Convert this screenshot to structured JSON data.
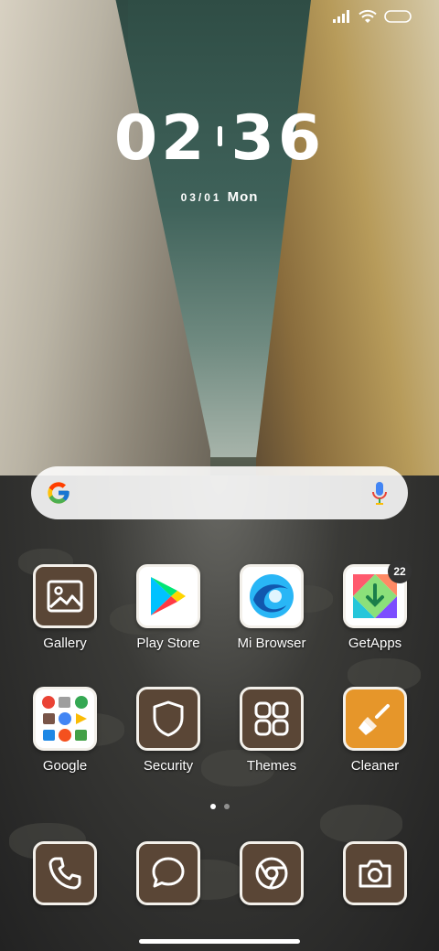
{
  "status": {
    "signal_icon": "signal-icon",
    "wifi_icon": "wifi-icon",
    "battery_icon": "battery-icon"
  },
  "clock": {
    "hours": "02",
    "minutes": "36"
  },
  "date": {
    "day": "03/01",
    "weekday": "Mon"
  },
  "search": {
    "google_icon": "google-g-icon",
    "mic_icon": "mic-icon"
  },
  "apps_row1": [
    {
      "label": "Gallery",
      "icon": "gallery-icon"
    },
    {
      "label": "Play Store",
      "icon": "play-store-icon"
    },
    {
      "label": "Mi Browser",
      "icon": "mi-browser-icon"
    },
    {
      "label": "GetApps",
      "icon": "getapps-icon",
      "badge": "22"
    }
  ],
  "apps_row2": [
    {
      "label": "Google",
      "icon": "google-folder-icon"
    },
    {
      "label": "Security",
      "icon": "shield-icon"
    },
    {
      "label": "Themes",
      "icon": "themes-icon"
    },
    {
      "label": "Cleaner",
      "icon": "broom-icon"
    }
  ],
  "dock": [
    {
      "icon": "phone-icon"
    },
    {
      "icon": "message-icon"
    },
    {
      "icon": "chrome-icon"
    },
    {
      "icon": "camera-icon"
    }
  ],
  "page_indicator": {
    "pages": 2,
    "active": 1
  },
  "colors": {
    "icon_bg": "#5a4636",
    "icon_border": "#f3f0ea",
    "cleaner_bg": "#e6962a",
    "badge_bg": "#333333"
  }
}
